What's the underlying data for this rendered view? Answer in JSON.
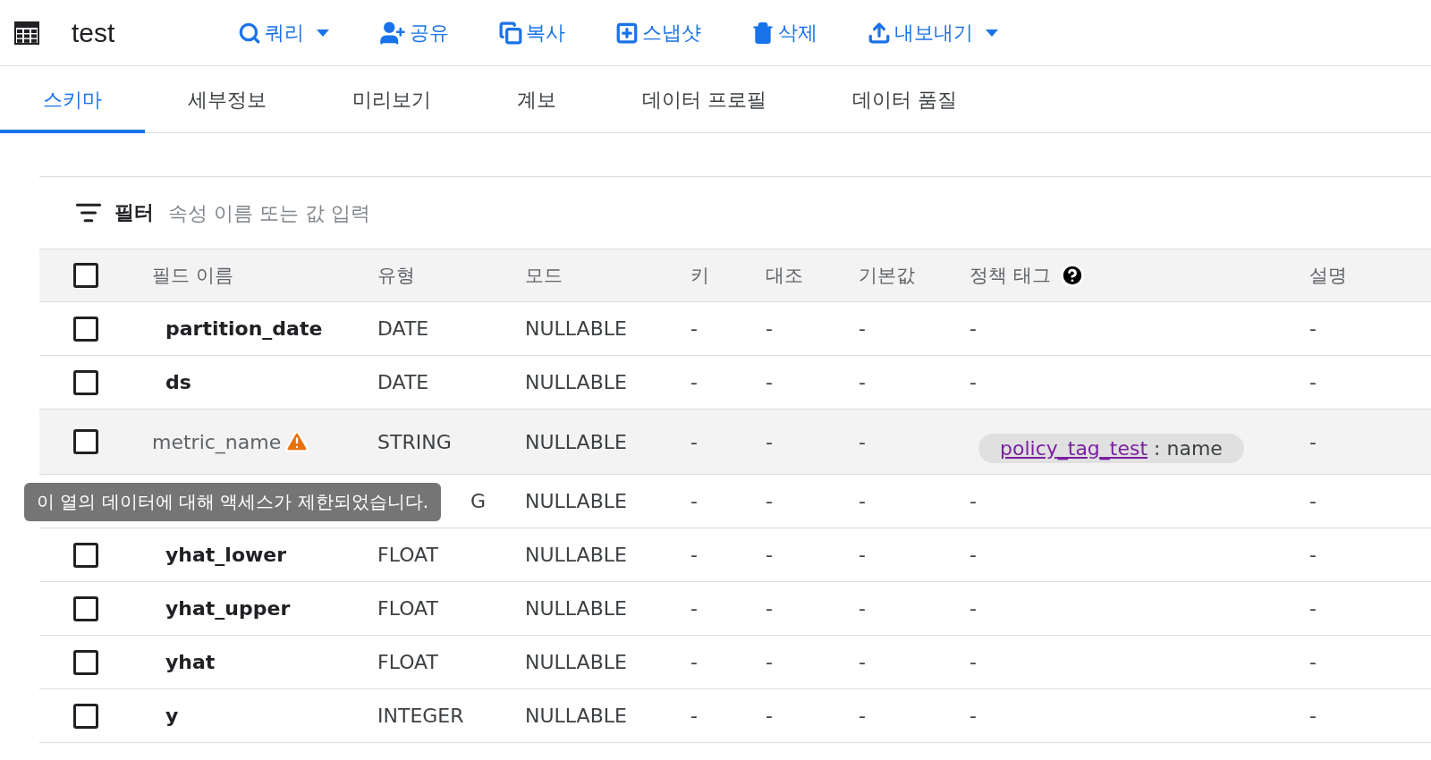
{
  "header": {
    "title": "test",
    "actions": [
      {
        "kind": "query",
        "label": "쿼리",
        "dropdown": true
      },
      {
        "kind": "share",
        "label": "공유",
        "dropdown": false
      },
      {
        "kind": "copy",
        "label": "복사",
        "dropdown": false
      },
      {
        "kind": "snapshot",
        "label": "스냅샷",
        "dropdown": false
      },
      {
        "kind": "delete",
        "label": "삭제",
        "dropdown": false
      },
      {
        "kind": "export",
        "label": "내보내기",
        "dropdown": true
      }
    ]
  },
  "tabs": [
    {
      "label": "스키마",
      "selected": true
    },
    {
      "label": "세부정보",
      "selected": false
    },
    {
      "label": "미리보기",
      "selected": false
    },
    {
      "label": "계보",
      "selected": false
    },
    {
      "label": "데이터 프로필",
      "selected": false
    },
    {
      "label": "데이터 품질",
      "selected": false
    }
  ],
  "filter": {
    "label": "필터",
    "placeholder": "속성 이름 또는 값 입력"
  },
  "table": {
    "select_all_checked": false,
    "columns": [
      "필드 이름",
      "유형",
      "모드",
      "키",
      "대조",
      "기본값",
      "정책 태그",
      "설명"
    ],
    "rows": [
      {
        "kind": "field",
        "checked": false,
        "restricted": false,
        "name": "partition_date",
        "type": "DATE",
        "mode": "NULLABLE",
        "key": "-",
        "collation": "-",
        "default": "-",
        "policy_tag": "-",
        "description": "-"
      },
      {
        "kind": "field",
        "checked": false,
        "restricted": false,
        "name": "ds",
        "type": "DATE",
        "mode": "NULLABLE",
        "key": "-",
        "collation": "-",
        "default": "-",
        "policy_tag": "-",
        "description": "-"
      },
      {
        "kind": "field",
        "checked": false,
        "restricted": true,
        "name": "metric_name",
        "type": "STRING",
        "mode": "NULLABLE",
        "key": "-",
        "collation": "-",
        "default": "-",
        "policy_tag_chip": {
          "tag": "policy_tag_test",
          "column": ": name"
        },
        "description": "-"
      },
      {
        "kind": "covered",
        "type": "G",
        "mode": "NULLABLE",
        "key": "-",
        "collation": "-",
        "default": "-",
        "policy_tag": "-",
        "description": "-"
      },
      {
        "kind": "field",
        "checked": false,
        "restricted": false,
        "name": "yhat_lower",
        "type": "FLOAT",
        "mode": "NULLABLE",
        "key": "-",
        "collation": "-",
        "default": "-",
        "policy_tag": "-",
        "description": "-"
      },
      {
        "kind": "field",
        "checked": false,
        "restricted": false,
        "name": "yhat_upper",
        "type": "FLOAT",
        "mode": "NULLABLE",
        "key": "-",
        "collation": "-",
        "default": "-",
        "policy_tag": "-",
        "description": "-"
      },
      {
        "kind": "field",
        "checked": false,
        "restricted": false,
        "name": "yhat",
        "type": "FLOAT",
        "mode": "NULLABLE",
        "key": "-",
        "collation": "-",
        "default": "-",
        "policy_tag": "-",
        "description": "-"
      },
      {
        "kind": "field",
        "checked": false,
        "restricted": false,
        "name": "y",
        "type": "INTEGER",
        "mode": "NULLABLE",
        "key": "-",
        "collation": "-",
        "default": "-",
        "policy_tag": "-",
        "description": "-"
      }
    ]
  },
  "tooltip": "이 열의 데이터에 대해 액세스가 제한되었습니다."
}
